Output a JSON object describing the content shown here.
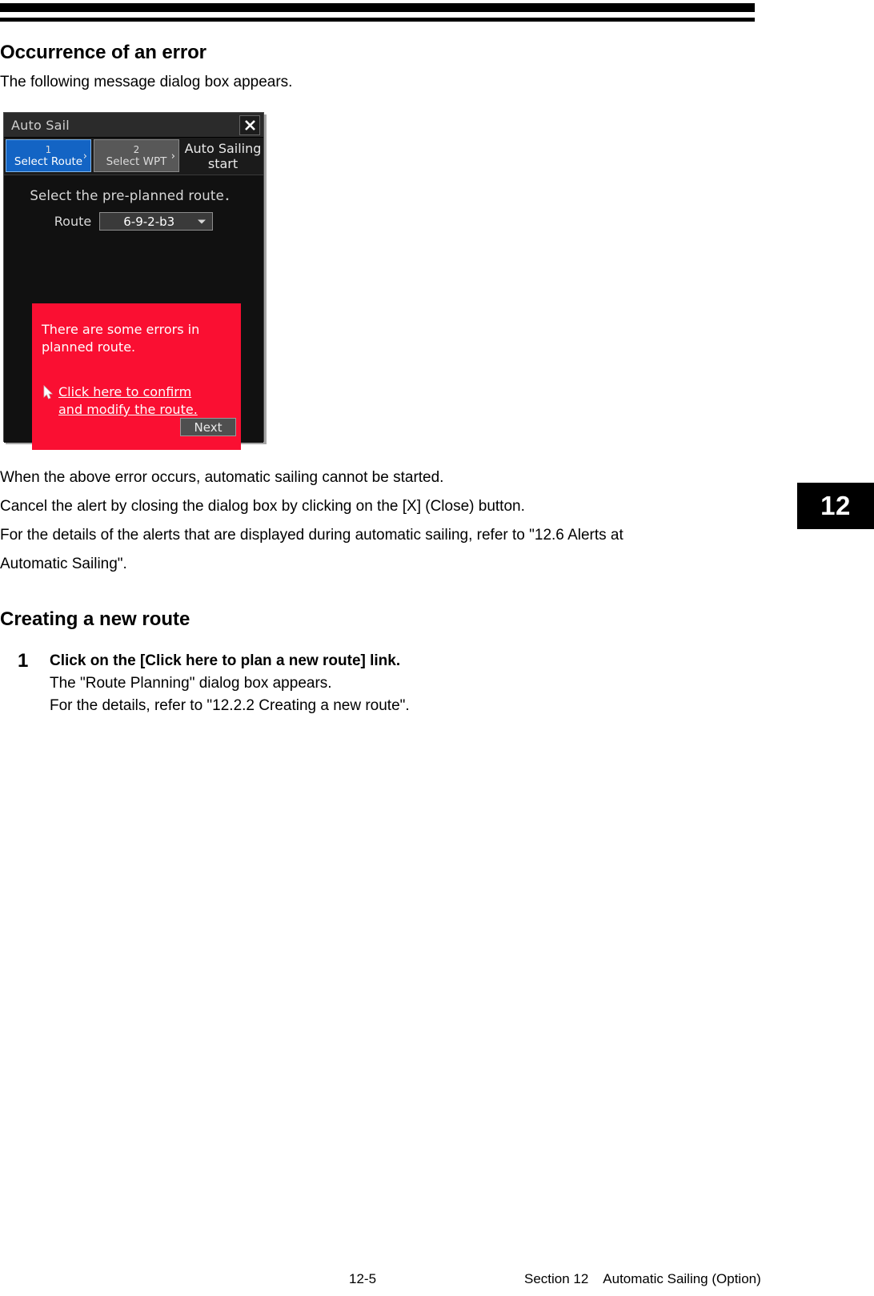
{
  "page": {
    "heading_error": "Occurrence of an error",
    "intro": "The following message dialog box appears.",
    "paragraphs": [
      "When the above error occurs, automatic sailing cannot be started.",
      "Cancel the alert by closing the dialog box by clicking on the [X] (Close) button.",
      "For the details of the alerts that are displayed during automatic sailing, refer to \"12.6 Alerts at",
      "Automatic Sailing\"."
    ],
    "heading_new_route": "Creating a new route",
    "step": {
      "number": "1",
      "title": "Click on the [Click here to plan a new route] link.",
      "line2": "The \"Route Planning\" dialog box appears.",
      "line3": "For the details, refer to \"12.2.2 Creating a new route\"."
    },
    "section_tab": "12",
    "footer": {
      "page_number": "12-5",
      "section": "Section 12    Automatic Sailing (Option)"
    }
  },
  "dialog": {
    "title": "Auto Sail",
    "close_icon": "close-icon",
    "tabs": [
      {
        "number": "1",
        "label": "Select Route",
        "chevron": "›",
        "state": "active"
      },
      {
        "number": "2",
        "label": "Select WPT",
        "chevron": "›",
        "state": "inactive"
      }
    ],
    "start_label_line1": "Auto Sailing",
    "start_label_line2": "start",
    "prompt": "Select the pre-planned route．",
    "route_field": {
      "label": "Route",
      "value": "6-9-2-b3",
      "caret_icon": "chevron-down-icon"
    },
    "error": {
      "message": "There are some errors in planned route.",
      "link_text": "Click here to confirm and modify the route.",
      "icon": "cursor-pointer-icon",
      "background_color": "#fa0f32",
      "text_color": "#ffffff"
    },
    "next_button": "Next",
    "colors": {
      "dialog_background": "#111111",
      "titlebar": "#2b2b2b",
      "active_tab": "#1364c4",
      "inactive_tab": "#585858"
    }
  }
}
